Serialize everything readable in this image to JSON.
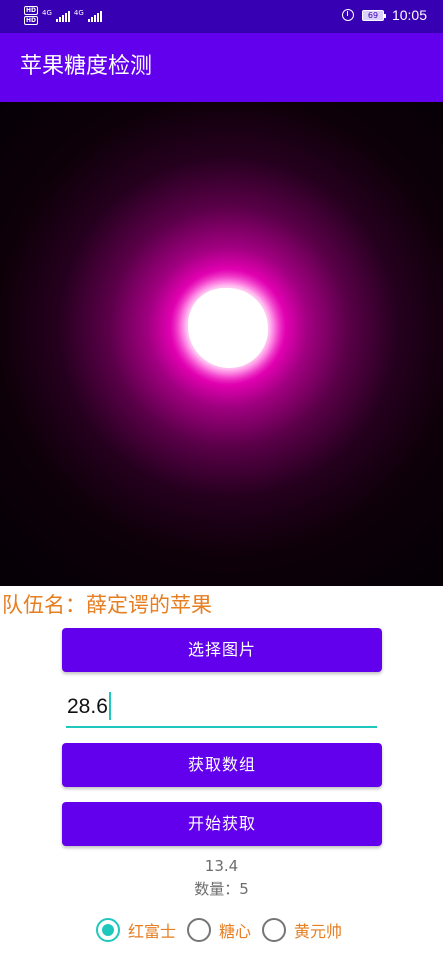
{
  "status_bar": {
    "left_badges": [
      "HD",
      "HD"
    ],
    "net_labels": [
      "4G",
      "4G"
    ],
    "battery": "69",
    "time": "10:05",
    "icons": [
      "alarm-icon",
      "battery-icon",
      "signal-icon"
    ]
  },
  "app_bar": {
    "title": "苹果糖度检测"
  },
  "image": {
    "description_icon": "photo-preview"
  },
  "team": {
    "label": "队伍名：薛定谔的苹果"
  },
  "buttons": {
    "select_image": "选择图片",
    "get_array": "获取数组",
    "start_fetch": "开始获取"
  },
  "input": {
    "value": "28.6"
  },
  "stats": {
    "value": "13.4",
    "count": "数量：5"
  },
  "radios": [
    {
      "label": "红富士",
      "checked": true
    },
    {
      "label": "糖心",
      "checked": false
    },
    {
      "label": "黄元帅",
      "checked": false
    }
  ],
  "colors": {
    "status_bar": "#3700b3",
    "app_bar": "#6200ee",
    "button": "#6200ee",
    "accent": "#1ec8bd",
    "team_text": "#e67e22"
  }
}
